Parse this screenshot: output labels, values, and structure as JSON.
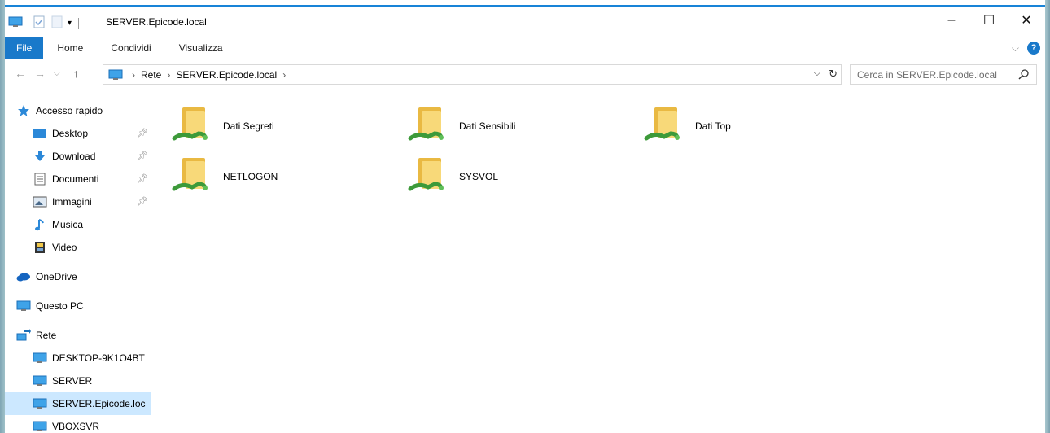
{
  "window": {
    "title": "SERVER.Epicode.local",
    "controls": [
      "–",
      "☐",
      "✕"
    ]
  },
  "ribbon": {
    "tabs": [
      {
        "label": "File",
        "active": true
      },
      {
        "label": "Home"
      },
      {
        "label": "Condividi"
      },
      {
        "label": "Visualizza"
      }
    ],
    "help": "?"
  },
  "address": {
    "breadcrumbs": [
      "Rete",
      "SERVER.Epicode.local"
    ],
    "search_placeholder": "Cerca in SERVER.Epicode.local"
  },
  "sidebar": {
    "items": [
      {
        "label": "Accesso rapido",
        "icon": "star-icon",
        "level": 0,
        "pinned": false
      },
      {
        "label": "Desktop",
        "icon": "desktop-folder-icon",
        "level": 1,
        "pinned": true
      },
      {
        "label": "Download",
        "icon": "download-arrow-icon",
        "level": 1,
        "pinned": true
      },
      {
        "label": "Documenti",
        "icon": "document-icon",
        "level": 1,
        "pinned": true
      },
      {
        "label": "Immagini",
        "icon": "image-icon",
        "level": 1,
        "pinned": true
      },
      {
        "label": "Musica",
        "icon": "music-note-icon",
        "level": 1,
        "pinned": false
      },
      {
        "label": "Video",
        "icon": "film-icon",
        "level": 1,
        "pinned": false
      },
      {
        "label": "OneDrive",
        "icon": "cloud-icon",
        "level": 0,
        "pinned": false
      },
      {
        "label": "Questo PC",
        "icon": "monitor-icon",
        "level": 0,
        "pinned": false
      },
      {
        "label": "Rete",
        "icon": "network-icon",
        "level": 0,
        "pinned": false
      },
      {
        "label": "DESKTOP-9K1O4BT",
        "icon": "monitor-icon",
        "level": 1,
        "pinned": false
      },
      {
        "label": "SERVER",
        "icon": "monitor-icon",
        "level": 1,
        "pinned": false
      },
      {
        "label": "SERVER.Epicode.loc",
        "icon": "monitor-icon",
        "level": 1,
        "pinned": false,
        "selected": true
      },
      {
        "label": "VBOXSVR",
        "icon": "monitor-icon",
        "level": 1,
        "pinned": false
      }
    ]
  },
  "content": {
    "shares": [
      {
        "label": "Dati Segreti"
      },
      {
        "label": "Dati Sensibili"
      },
      {
        "label": "Dati Top"
      },
      {
        "label": "NETLOGON"
      },
      {
        "label": "SYSVOL"
      }
    ]
  },
  "colors": {
    "accent": "#1979ca",
    "selection": "#cce8ff",
    "folder": "#f3cf67",
    "share_cable": "#49a846"
  }
}
